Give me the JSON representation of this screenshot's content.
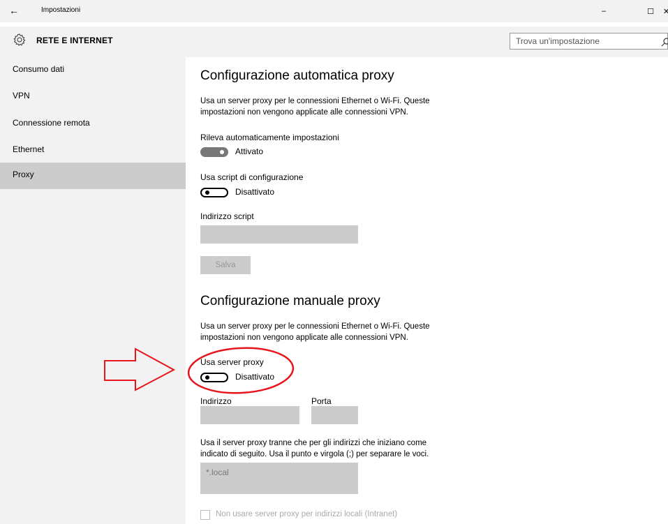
{
  "window": {
    "back_glyph": "←",
    "title": "Impostazioni",
    "minimize_glyph": "–",
    "maximize_glyph": "☐",
    "close_glyph": "✕"
  },
  "header": {
    "title": "RETE E INTERNET",
    "icon": "gear-icon",
    "search": {
      "placeholder": "Trova un'impostazione",
      "value": "",
      "icon": "search-icon"
    }
  },
  "sidebar": {
    "items": [
      {
        "label": "Consumo dati",
        "selected": false
      },
      {
        "label": "VPN",
        "selected": false
      },
      {
        "label": "Connessione remota",
        "selected": false
      },
      {
        "label": "Ethernet",
        "selected": false
      },
      {
        "label": "Proxy",
        "selected": true
      }
    ]
  },
  "auto_proxy": {
    "heading": "Configurazione automatica proxy",
    "description_line1": "Usa un server proxy per le connessioni Ethernet o Wi-Fi. Queste",
    "description_line2": "impostazioni non vengono applicate alle connessioni VPN.",
    "detect": {
      "label": "Rileva automaticamente impostazioni",
      "state_label": "Attivato",
      "on": true
    },
    "script": {
      "label": "Usa script di configurazione",
      "state_label": "Disattivato",
      "on": false
    },
    "script_address": {
      "label": "Indirizzo script",
      "value": ""
    },
    "save_label": "Salva"
  },
  "manual_proxy": {
    "heading": "Configurazione manuale proxy",
    "description_line1": "Usa un server proxy per le connessioni Ethernet o Wi-Fi. Queste",
    "description_line2": "impostazioni non vengono applicate alle connessioni VPN.",
    "use_proxy": {
      "label": "Usa server proxy",
      "state_label": "Disattivato",
      "on": false
    },
    "address": {
      "label": "Indirizzo",
      "value": ""
    },
    "port": {
      "label": "Porta",
      "value": ""
    },
    "exceptions_line1": "Usa il server proxy tranne che per gli indirizzi che iniziano come",
    "exceptions_line2": "indicato di seguito. Usa il punto e virgola (;) per separare le voci.",
    "exceptions_value": "*.local",
    "bypass_local": {
      "label": "Non usare server proxy per indirizzi locali (Intranet)",
      "checked": false
    }
  },
  "colors": {
    "annotation_red": "#e8141c",
    "sidebar_bg": "#f2f2f2",
    "selected_bg": "#cccccc",
    "field_bg": "#cccccc"
  }
}
